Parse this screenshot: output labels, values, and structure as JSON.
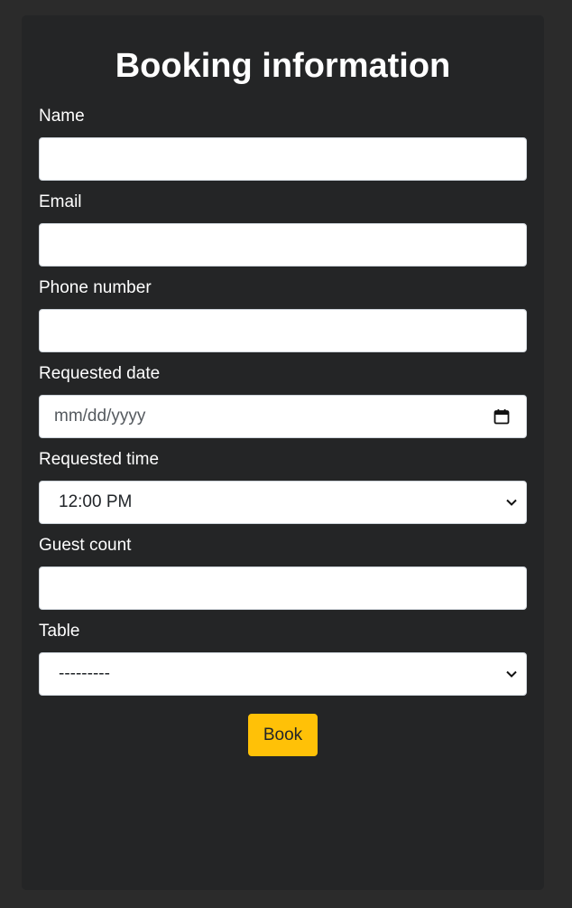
{
  "form": {
    "title": "Booking information",
    "fields": {
      "name": {
        "label": "Name",
        "value": ""
      },
      "email": {
        "label": "Email",
        "value": ""
      },
      "phone": {
        "label": "Phone number",
        "value": ""
      },
      "date": {
        "label": "Requested date",
        "placeholder": "mm/dd/yyyy"
      },
      "time": {
        "label": "Requested time",
        "selected": "12:00 PM"
      },
      "guests": {
        "label": "Guest count",
        "value": ""
      },
      "table": {
        "label": "Table",
        "selected": "---------"
      }
    },
    "submit_label": "Book"
  },
  "colors": {
    "page_bg": "#2b2b2b",
    "card_bg": "#242526",
    "accent": "#ffc107"
  }
}
